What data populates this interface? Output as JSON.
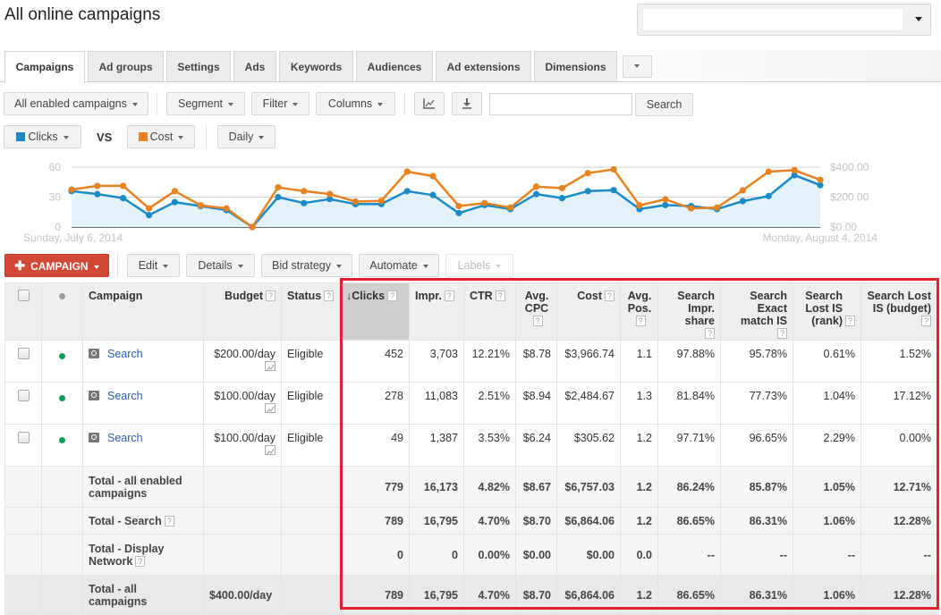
{
  "header": {
    "title": "All online campaigns",
    "account_selector_value": ""
  },
  "tabs": [
    {
      "label": "Campaigns",
      "active": true
    },
    {
      "label": "Ad groups"
    },
    {
      "label": "Settings"
    },
    {
      "label": "Ads"
    },
    {
      "label": "Keywords"
    },
    {
      "label": "Audiences"
    },
    {
      "label": "Ad extensions"
    },
    {
      "label": "Dimensions"
    }
  ],
  "toolbar": {
    "filter_view": "All enabled campaigns",
    "segment": "Segment",
    "filter": "Filter",
    "columns": "Columns",
    "chart_icon": "line-chart-icon",
    "download_icon": "download-icon",
    "search_placeholder": "",
    "search_value": "",
    "search_button": "Search"
  },
  "chart_controls": {
    "metric1": "Clicks",
    "metric1_color": "#1a8bc6",
    "vs": "VS",
    "metric2": "Cost",
    "metric2_color": "#e8811f",
    "granularity": "Daily"
  },
  "chart_data": {
    "type": "line",
    "title": "",
    "x_start_label": "Sunday, July 6, 2014",
    "x_end_label": "Monday, August 4, 2014",
    "left_axis": {
      "label": "Clicks",
      "ticks": [
        "0",
        "30",
        "60"
      ],
      "range": [
        0,
        60
      ]
    },
    "right_axis": {
      "label": "Cost",
      "ticks": [
        "$0.00",
        "$200.00",
        "$400.00"
      ],
      "range": [
        0,
        400
      ]
    },
    "grid": true,
    "series": [
      {
        "name": "Clicks",
        "axis": "left",
        "color": "#1a8bc6",
        "area": true,
        "values": [
          36,
          33,
          29,
          12,
          25,
          21,
          17,
          0,
          30,
          24,
          28,
          23,
          23,
          36,
          32,
          14,
          22,
          18,
          33,
          29,
          36,
          37,
          18,
          22,
          21,
          18,
          26,
          31,
          52,
          42
        ]
      },
      {
        "name": "Cost",
        "axis": "right",
        "color": "#e8811f",
        "area": false,
        "values": [
          250,
          275,
          275,
          125,
          240,
          145,
          125,
          0,
          265,
          240,
          220,
          170,
          175,
          370,
          340,
          140,
          160,
          130,
          270,
          260,
          360,
          385,
          145,
          185,
          125,
          130,
          245,
          370,
          380,
          315
        ]
      }
    ]
  },
  "actions": {
    "new_campaign": "CAMPAIGN",
    "edit": "Edit",
    "details": "Details",
    "bid_strategy": "Bid strategy",
    "automate": "Automate",
    "labels": "Labels"
  },
  "table": {
    "columns": [
      {
        "label": "",
        "key": "select"
      },
      {
        "label": "",
        "key": "status_dot"
      },
      {
        "label": "Campaign"
      },
      {
        "label": "Budget",
        "help": true
      },
      {
        "label": "Status",
        "help": true
      },
      {
        "label": "Clicks",
        "help": true,
        "sorted": "desc"
      },
      {
        "label": "Impr.",
        "help": true
      },
      {
        "label": "CTR",
        "help": true
      },
      {
        "label": "Avg. CPC",
        "help": true
      },
      {
        "label": "Cost",
        "help": true
      },
      {
        "label": "Avg. Pos.",
        "help": true
      },
      {
        "label": "Search Impr. share",
        "help": true
      },
      {
        "label": "Search Exact match IS",
        "help": true
      },
      {
        "label": "Search Lost IS (rank)",
        "help": true
      },
      {
        "label": "Search Lost IS (budget)",
        "help": true
      }
    ],
    "rows": [
      {
        "campaign": "Search",
        "budget": "$200.00/day",
        "status": "Eligible",
        "clicks": "452",
        "impr": "3,703",
        "ctr": "12.21%",
        "cpc": "$8.78",
        "cost": "$3,966.74",
        "pos": "1.1",
        "sis": "97.88%",
        "semis": "95.78%",
        "lost_rank": "0.61%",
        "lost_budget": "1.52%"
      },
      {
        "campaign": "Search",
        "budget": "$100.00/day",
        "status": "Eligible",
        "clicks": "278",
        "impr": "11,083",
        "ctr": "2.51%",
        "cpc": "$8.94",
        "cost": "$2,484.67",
        "pos": "1.3",
        "sis": "81.84%",
        "semis": "77.73%",
        "lost_rank": "1.04%",
        "lost_budget": "17.12%"
      },
      {
        "campaign": "Search",
        "budget": "$100.00/day",
        "status": "Eligible",
        "clicks": "49",
        "impr": "1,387",
        "ctr": "3.53%",
        "cpc": "$6.24",
        "cost": "$305.62",
        "pos": "1.2",
        "sis": "97.71%",
        "semis": "96.65%",
        "lost_rank": "2.29%",
        "lost_budget": "0.00%"
      }
    ],
    "totals": [
      {
        "label": "Total - all enabled campaigns",
        "budget": "",
        "clicks": "779",
        "impr": "16,173",
        "ctr": "4.82%",
        "cpc": "$8.67",
        "cost": "$6,757.03",
        "pos": "1.2",
        "sis": "86.24%",
        "semis": "85.87%",
        "lost_rank": "1.05%",
        "lost_budget": "12.71%"
      },
      {
        "label": "Total - Search",
        "help": true,
        "budget": "",
        "clicks": "789",
        "impr": "16,795",
        "ctr": "4.70%",
        "cpc": "$8.70",
        "cost": "$6,864.06",
        "pos": "1.2",
        "sis": "86.65%",
        "semis": "86.31%",
        "lost_rank": "1.06%",
        "lost_budget": "12.28%"
      },
      {
        "label": "Total - Display Network",
        "help": true,
        "budget": "",
        "clicks": "0",
        "impr": "0",
        "ctr": "0.00%",
        "cpc": "$0.00",
        "cost": "$0.00",
        "pos": "0.0",
        "sis": "--",
        "semis": "--",
        "lost_rank": "--",
        "lost_budget": "--"
      },
      {
        "label": "Total - all campaigns",
        "budget": "$400.00/day",
        "clicks": "789",
        "impr": "16,795",
        "ctr": "4.70%",
        "cpc": "$8.70",
        "cost": "$6,864.06",
        "pos": "1.2",
        "sis": "86.65%",
        "semis": "86.31%",
        "lost_rank": "1.06%",
        "lost_budget": "12.28%"
      }
    ],
    "status_dot_color": "#0f9d58",
    "highlight_color": "#e0202a"
  }
}
